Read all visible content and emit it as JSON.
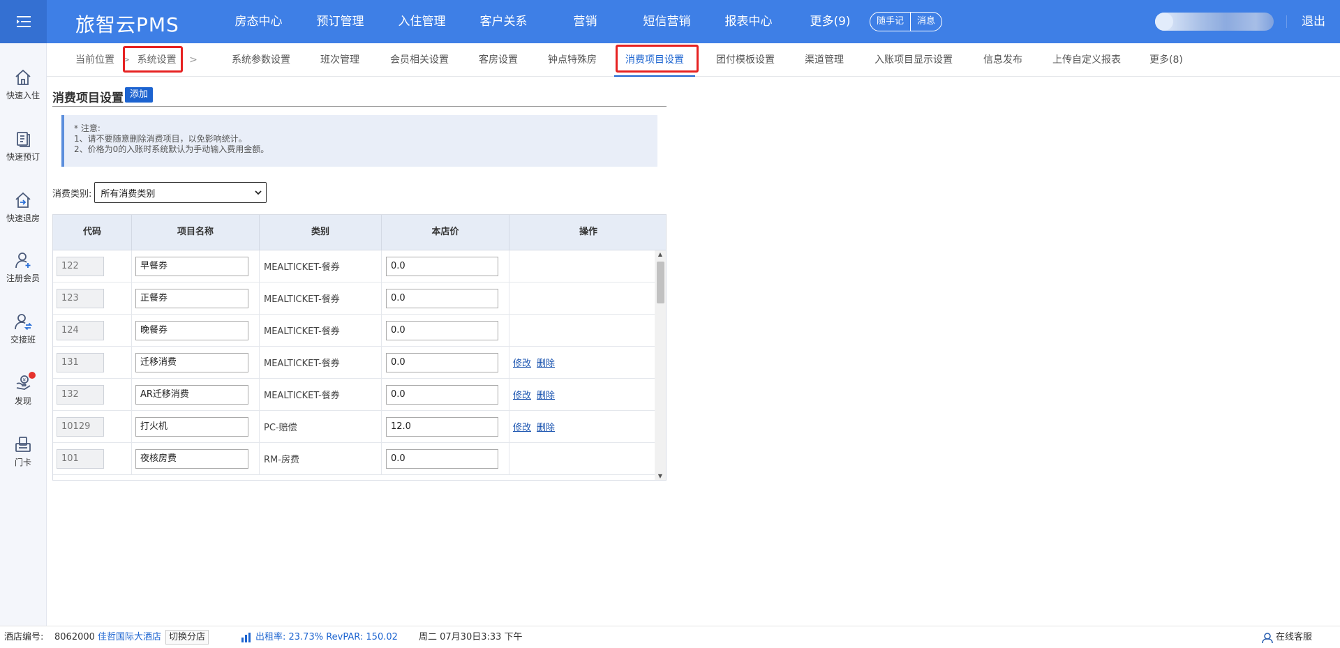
{
  "header": {
    "brand": "旅智云PMS",
    "nav": [
      "房态中心",
      "预订管理",
      "入住管理",
      "客户关系",
      "营销",
      "短信营销",
      "报表中心",
      "更多(9)"
    ],
    "notes_label": "随手记",
    "messages_label": "消息",
    "logout_label": "退出"
  },
  "sidebar": {
    "items": [
      {
        "label": "快速入住",
        "icon": "home-icon"
      },
      {
        "label": "快速预订",
        "icon": "booking-icon"
      },
      {
        "label": "快速退房",
        "icon": "checkout-icon"
      },
      {
        "label": "注册会员",
        "icon": "add-member-icon"
      },
      {
        "label": "交接班",
        "icon": "shift-handover-icon"
      },
      {
        "label": "发现",
        "icon": "discover-icon"
      },
      {
        "label": "门卡",
        "icon": "door-card-icon"
      }
    ]
  },
  "subnav": {
    "crumb_label": "当前位置",
    "crumb_current": "系统设置",
    "items": [
      "系统参数设置",
      "班次管理",
      "会员相关设置",
      "客房设置",
      "钟点特殊房",
      "消费项目设置",
      "团付模板设置",
      "渠道管理",
      "入账项目显示设置",
      "信息发布",
      "上传自定义报表",
      "更多(8)"
    ],
    "active": "消费项目设置"
  },
  "page": {
    "title": "消费项目设置",
    "add_label": "添加",
    "notice": [
      "* 注意:",
      "1、请不要随意删除消费项目，以免影响统计。",
      "2、价格为0的入账时系统默认为手动输入费用金额。"
    ],
    "filter_label": "消费类别:",
    "filter_value": "所有消费类别"
  },
  "table": {
    "headers": [
      "代码",
      "项目名称",
      "类别",
      "本店价",
      "操作"
    ],
    "rows": [
      {
        "code": "122",
        "name": "早餐券",
        "category": "MEALTICKET-餐券",
        "price": "0.0",
        "actions": []
      },
      {
        "code": "123",
        "name": "正餐券",
        "category": "MEALTICKET-餐券",
        "price": "0.0",
        "actions": []
      },
      {
        "code": "124",
        "name": "晚餐券",
        "category": "MEALTICKET-餐券",
        "price": "0.0",
        "actions": []
      },
      {
        "code": "131",
        "name": "迁移消费",
        "category": "MEALTICKET-餐券",
        "price": "0.0",
        "actions": [
          "修改",
          "删除"
        ]
      },
      {
        "code": "132",
        "name": "AR迁移消费",
        "category": "MEALTICKET-餐券",
        "price": "0.0",
        "actions": [
          "修改",
          "删除"
        ]
      },
      {
        "code": "10129",
        "name": "打火机",
        "category": "PC-赔偿",
        "price": "12.0",
        "actions": [
          "修改",
          "删除"
        ]
      },
      {
        "code": "101",
        "name": "夜核房费",
        "category": "RM-房费",
        "price": "0.0",
        "actions": []
      }
    ]
  },
  "footer": {
    "hotel_code_label": "酒店编号:",
    "hotel_code": "8062000",
    "hotel_name": "佳哲国际大酒店",
    "switch_label": "切换分店",
    "occupancy": "出租率: 23.73% RevPAR: 150.02",
    "datetime": "周二 07月30日3:33 下午",
    "support_label": "在线客服"
  },
  "colors": {
    "topbar": "#3e7fe6",
    "accent": "#1c64d0",
    "highlight_box": "#e62222",
    "notification_dot": "#e5322d"
  }
}
